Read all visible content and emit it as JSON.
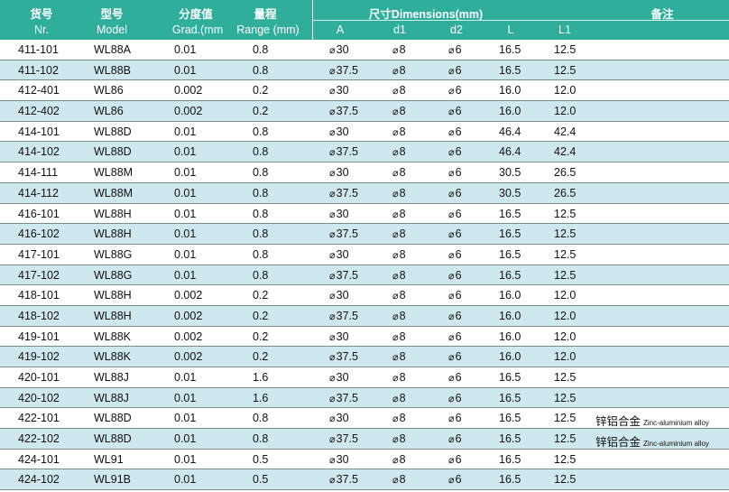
{
  "header": {
    "cn": {
      "nr": "货号",
      "model": "型号",
      "grad": "分度值",
      "range": "量程",
      "dimensions": "尺寸Dimensions(mm)",
      "note": "备注"
    },
    "en": {
      "nr": "Nr.",
      "model": "Model",
      "grad": "Grad.(mm",
      "range": "Range (mm)",
      "a": "A",
      "d1": "d1",
      "d2": "d2",
      "l": "L",
      "l1": "L1"
    }
  },
  "diameter_symbol": "⌀",
  "rows": [
    {
      "nr": "411-101",
      "model": "WL88A",
      "grad": "0.01",
      "range": "0.8",
      "a": "30",
      "d1": "8",
      "d2": "6",
      "l": "16.5",
      "l1": "12.5",
      "note": "",
      "note_en": ""
    },
    {
      "nr": "411-102",
      "model": "WL88B",
      "grad": "0.01",
      "range": "0.8",
      "a": "37.5",
      "d1": "8",
      "d2": "6",
      "l": "16.5",
      "l1": "12.5",
      "note": "",
      "note_en": ""
    },
    {
      "nr": "412-401",
      "model": "WL86",
      "grad": "0.002",
      "range": "0.2",
      "a": "30",
      "d1": "8",
      "d2": "6",
      "l": "16.0",
      "l1": "12.0",
      "note": "",
      "note_en": ""
    },
    {
      "nr": "412-402",
      "model": "WL86",
      "grad": "0.002",
      "range": "0.2",
      "a": "37.5",
      "d1": "8",
      "d2": "6",
      "l": "16.0",
      "l1": "12.0",
      "note": "",
      "note_en": ""
    },
    {
      "nr": "414-101",
      "model": "WL88D",
      "grad": "0.01",
      "range": "0.8",
      "a": "30",
      "d1": "8",
      "d2": "6",
      "l": "46.4",
      "l1": "42.4",
      "note": "",
      "note_en": ""
    },
    {
      "nr": "414-102",
      "model": "WL88D",
      "grad": "0.01",
      "range": "0.8",
      "a": "37.5",
      "d1": "8",
      "d2": "6",
      "l": "46.4",
      "l1": "42.4",
      "note": "",
      "note_en": ""
    },
    {
      "nr": "414-111",
      "model": "WL88M",
      "grad": "0.01",
      "range": "0.8",
      "a": "30",
      "d1": "8",
      "d2": "6",
      "l": "30.5",
      "l1": "26.5",
      "note": "",
      "note_en": ""
    },
    {
      "nr": "414-112",
      "model": "WL88M",
      "grad": "0.01",
      "range": "0.8",
      "a": "37.5",
      "d1": "8",
      "d2": "6",
      "l": "30.5",
      "l1": "26.5",
      "note": "",
      "note_en": ""
    },
    {
      "nr": "416-101",
      "model": "WL88H",
      "grad": "0.01",
      "range": "0.8",
      "a": "30",
      "d1": "8",
      "d2": "6",
      "l": "16.5",
      "l1": "12.5",
      "note": "",
      "note_en": ""
    },
    {
      "nr": "416-102",
      "model": "WL88H",
      "grad": "0.01",
      "range": "0.8",
      "a": "37.5",
      "d1": "8",
      "d2": "6",
      "l": "16.5",
      "l1": "12.5",
      "note": "",
      "note_en": ""
    },
    {
      "nr": "417-101",
      "model": "WL88G",
      "grad": "0.01",
      "range": "0.8",
      "a": "30",
      "d1": "8",
      "d2": "6",
      "l": "16.5",
      "l1": "12.5",
      "note": "",
      "note_en": ""
    },
    {
      "nr": "417-102",
      "model": "WL88G",
      "grad": "0.01",
      "range": "0.8",
      "a": "37.5",
      "d1": "8",
      "d2": "6",
      "l": "16.5",
      "l1": "12.5",
      "note": "",
      "note_en": ""
    },
    {
      "nr": "418-101",
      "model": "WL88H",
      "grad": "0.002",
      "range": "0.2",
      "a": "30",
      "d1": "8",
      "d2": "6",
      "l": "16.0",
      "l1": "12.0",
      "note": "",
      "note_en": ""
    },
    {
      "nr": "418-102",
      "model": "WL88H",
      "grad": "0.002",
      "range": "0.2",
      "a": "37.5",
      "d1": "8",
      "d2": "6",
      "l": "16.0",
      "l1": "12.0",
      "note": "",
      "note_en": ""
    },
    {
      "nr": "419-101",
      "model": "WL88K",
      "grad": "0.002",
      "range": "0.2",
      "a": "30",
      "d1": "8",
      "d2": "6",
      "l": "16.0",
      "l1": "12.0",
      "note": "",
      "note_en": ""
    },
    {
      "nr": "419-102",
      "model": "WL88K",
      "grad": "0.002",
      "range": "0.2",
      "a": "37.5",
      "d1": "8",
      "d2": "6",
      "l": "16.0",
      "l1": "12.0",
      "note": "",
      "note_en": ""
    },
    {
      "nr": "420-101",
      "model": "WL88J",
      "grad": "0.01",
      "range": "1.6",
      "a": "30",
      "d1": "8",
      "d2": "6",
      "l": "16.5",
      "l1": "12.5",
      "note": "",
      "note_en": ""
    },
    {
      "nr": "420-102",
      "model": "WL88J",
      "grad": "0.01",
      "range": "1.6",
      "a": "37.5",
      "d1": "8",
      "d2": "6",
      "l": "16.5",
      "l1": "12.5",
      "note": "",
      "note_en": ""
    },
    {
      "nr": "422-101",
      "model": "WL88D",
      "grad": "0.01",
      "range": "0.8",
      "a": "30",
      "d1": "8",
      "d2": "6",
      "l": "16.5",
      "l1": "12.5",
      "note": "锌铝合金",
      "note_en": "Zinc-aluminium alloy"
    },
    {
      "nr": "422-102",
      "model": "WL88D",
      "grad": "0.01",
      "range": "0.8",
      "a": "37.5",
      "d1": "8",
      "d2": "6",
      "l": "16.5",
      "l1": "12.5",
      "note": "锌铝合金",
      "note_en": "Zinc-aluminium alloy"
    },
    {
      "nr": "424-101",
      "model": "WL91",
      "grad": "0.01",
      "range": "0.5",
      "a": "30",
      "d1": "8",
      "d2": "6",
      "l": "16.5",
      "l1": "12.5",
      "note": "",
      "note_en": ""
    },
    {
      "nr": "424-102",
      "model": "WL91B",
      "grad": "0.01",
      "range": "0.5",
      "a": "37.5",
      "d1": "8",
      "d2": "6",
      "l": "16.5",
      "l1": "12.5",
      "note": "",
      "note_en": ""
    }
  ],
  "colors": {
    "header_bg": "#2fae9b",
    "alt_row_bg": "#cfe7ef",
    "divider": "#7c8a8a"
  }
}
